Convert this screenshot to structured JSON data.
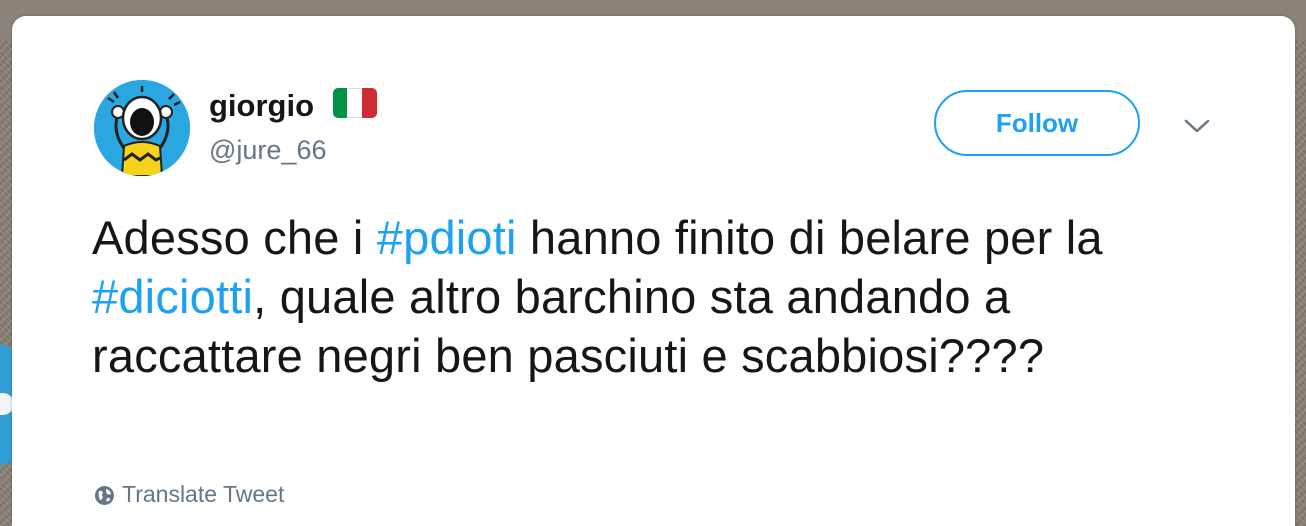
{
  "user": {
    "display_name": "giorgio",
    "handle": "@jure_66",
    "flag_icon": "italy-flag-icon",
    "flag_colors": [
      "#009246",
      "#ffffff",
      "#ce2b37"
    ],
    "avatar_icon": "cartoon-avatar-icon"
  },
  "actions": {
    "follow_label": "Follow",
    "menu_icon": "chevron-down-icon"
  },
  "tweet": {
    "segments": [
      {
        "text": "Adesso che i ",
        "type": "text"
      },
      {
        "text": "#pdioti",
        "type": "hashtag"
      },
      {
        "text": " hanno finito di belare per la ",
        "type": "text"
      },
      {
        "text": "#diciotti",
        "type": "hashtag"
      },
      {
        "text": ", quale altro barchino sta andando a raccattare negri ben pasciuti e scabbiosi????",
        "type": "text"
      }
    ]
  },
  "footer": {
    "translate_label": "Translate Tweet",
    "translate_icon": "globe-icon"
  },
  "colors": {
    "accent": "#1da1f2",
    "text": "#14171a",
    "secondary": "#657786",
    "avatar_bg": "#2aa7e0"
  }
}
